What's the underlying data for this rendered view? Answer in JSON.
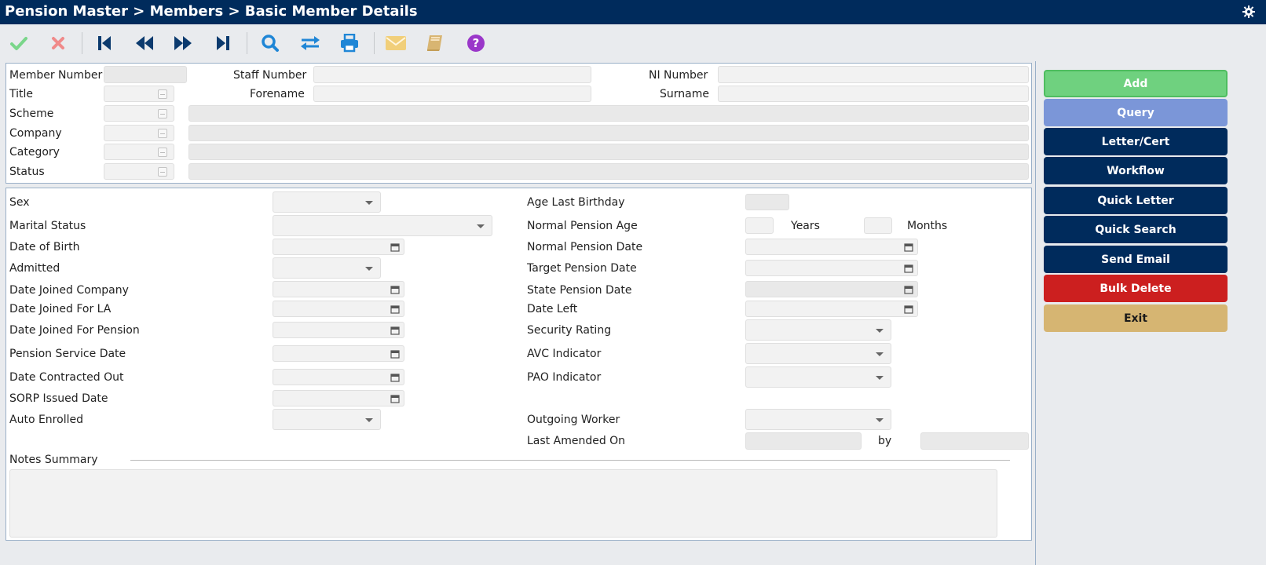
{
  "header": {
    "breadcrumb": "Pension Master > Members > Basic Member Details"
  },
  "toolbar": {
    "icons": [
      "check-icon",
      "cross-icon",
      "first-record-icon",
      "previous-record-icon",
      "next-record-icon",
      "last-record-icon",
      "search-icon",
      "swap-icon",
      "print-icon",
      "mail-icon",
      "book-icon",
      "help-icon"
    ],
    "colors": {
      "check": "#7ad68a",
      "cross": "#f08a8a",
      "nav": "#0b3a6e",
      "blue": "#1f86d6",
      "mail": "#f1cf7a",
      "book": "#d8b572",
      "help": "#9a37c9"
    }
  },
  "top_panel": {
    "member_number_label": "Member Number",
    "staff_number_label": "Staff Number",
    "ni_number_label": "NI Number",
    "title_label": "Title",
    "forename_label": "Forename",
    "surname_label": "Surname",
    "scheme_label": "Scheme",
    "company_label": "Company",
    "category_label": "Category",
    "status_label": "Status"
  },
  "details": {
    "sex_label": "Sex",
    "marital_status_label": "Marital Status",
    "dob_label": "Date of Birth",
    "admitted_label": "Admitted",
    "date_joined_company_label": "Date Joined Company",
    "date_joined_la_label": "Date Joined For LA",
    "date_joined_pension_label": "Date Joined For Pension",
    "pension_service_date_label": "Pension Service Date",
    "date_contracted_out_label": "Date Contracted Out",
    "sorp_label": "SORP Issued Date",
    "auto_enrolled_label": "Auto Enrolled",
    "age_last_birthday_label": "Age Last Birthday",
    "normal_pension_age_label": "Normal Pension Age",
    "years_label": "Years",
    "months_label": "Months",
    "normal_pension_date_label": "Normal Pension Date",
    "target_pension_date_label": "Target Pension Date",
    "state_pension_date_label": "State Pension Date",
    "date_left_label": "Date Left",
    "security_rating_label": "Security Rating",
    "avc_indicator_label": "AVC Indicator",
    "pao_indicator_label": "PAO Indicator",
    "outgoing_worker_label": "Outgoing Worker",
    "last_amended_label": "Last Amended On",
    "by_label": "by",
    "notes_summary_label": "Notes Summary"
  },
  "actions": [
    {
      "label": "Add",
      "color": "#6fd17f"
    },
    {
      "label": "Query",
      "color": "#7b96d8"
    },
    {
      "label": "Letter/Cert",
      "color": "#002b5c"
    },
    {
      "label": "Workflow",
      "color": "#002b5c"
    },
    {
      "label": "Quick Letter",
      "color": "#002b5c"
    },
    {
      "label": "Quick Search",
      "color": "#002b5c"
    },
    {
      "label": "Send Email",
      "color": "#002b5c"
    },
    {
      "label": "Bulk Delete",
      "color": "#cc1f1f"
    },
    {
      "label": "Exit",
      "color": "#d6b572"
    }
  ]
}
